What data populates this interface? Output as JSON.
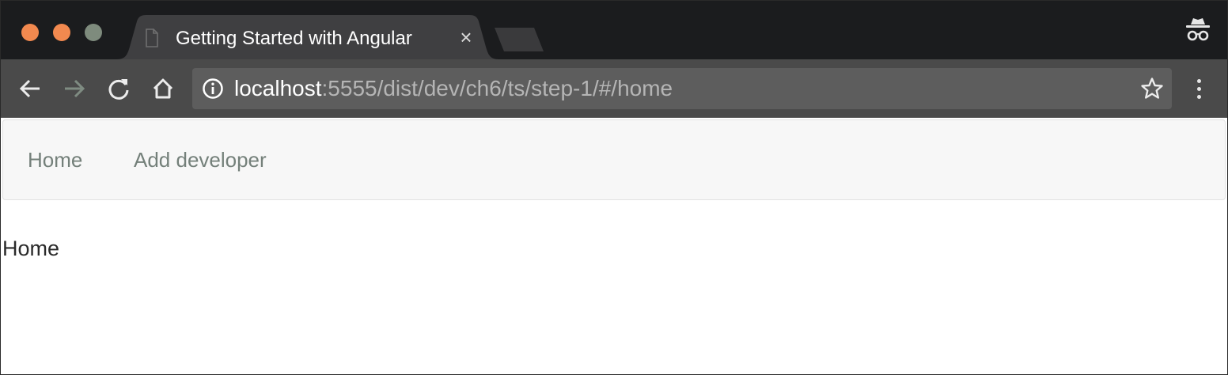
{
  "browser": {
    "tab": {
      "title": "Getting Started with Angular"
    },
    "address_bar": {
      "host": "localhost",
      "path": ":5555/dist/dev/ch6/ts/step-1/#/home"
    },
    "icons": {
      "back": "arrow-left-icon",
      "forward": "arrow-right-icon",
      "reload": "reload-icon",
      "home": "home-icon",
      "info": "info-icon",
      "bookmark": "star-icon",
      "menu": "kebab-menu-icon",
      "incognito": "incognito-icon"
    }
  },
  "page": {
    "navbar": {
      "links": [
        {
          "label": "Home"
        },
        {
          "label": "Add developer"
        }
      ]
    },
    "content": {
      "text": "Home"
    }
  },
  "colors": {
    "tabstrip": "#1b1c1e",
    "toolbar": "#4a4a4a",
    "omnibox": "#5d5d5d",
    "traffic_close": "#f2894f",
    "traffic_min": "#f2894f",
    "traffic_max": "#7e8b7d",
    "nav_link": "#74807a"
  }
}
